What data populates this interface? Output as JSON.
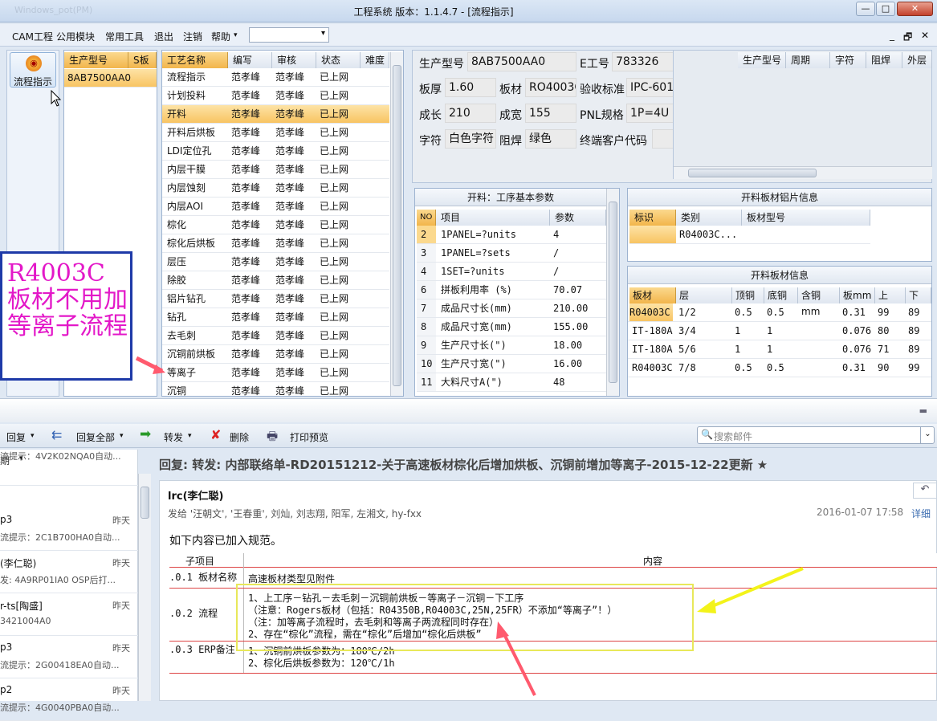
{
  "window": {
    "title": "工程系统  版本：1.1.4.7 - [流程指示]",
    "blurred_title": "Windows_pot(PM)",
    "min": "—",
    "max": "□",
    "close": "✕"
  },
  "menu": {
    "items": [
      "CAM工程",
      "公用模块",
      "常用工具",
      "退出",
      "注销",
      "帮助"
    ],
    "combo_value": "",
    "right_buttons": [
      "_",
      "🗗",
      "✕"
    ]
  },
  "leftnav": {
    "button_label": "流程指示"
  },
  "model_list": {
    "headers": [
      "生产型号",
      "S板"
    ],
    "rows": [
      "8AB7500AA0"
    ]
  },
  "process_list": {
    "headers": [
      "工艺名称",
      "编写",
      "审核",
      "状态",
      "难度"
    ],
    "rows": [
      [
        "流程指示",
        "范孝峰",
        "范孝峰",
        "已上网"
      ],
      [
        "计划投料",
        "范孝峰",
        "范孝峰",
        "已上网"
      ],
      [
        "开料",
        "范孝峰",
        "范孝峰",
        "已上网"
      ],
      [
        "开料后烘板",
        "范孝峰",
        "范孝峰",
        "已上网"
      ],
      [
        "LDI定位孔",
        "范孝峰",
        "范孝峰",
        "已上网"
      ],
      [
        "内层干膜",
        "范孝峰",
        "范孝峰",
        "已上网"
      ],
      [
        "内层蚀刻",
        "范孝峰",
        "范孝峰",
        "已上网"
      ],
      [
        "内层AOI",
        "范孝峰",
        "范孝峰",
        "已上网"
      ],
      [
        "棕化",
        "范孝峰",
        "范孝峰",
        "已上网"
      ],
      [
        "棕化后烘板",
        "范孝峰",
        "范孝峰",
        "已上网"
      ],
      [
        "层压",
        "范孝峰",
        "范孝峰",
        "已上网"
      ],
      [
        "除胶",
        "范孝峰",
        "范孝峰",
        "已上网"
      ],
      [
        "铝片钻孔",
        "范孝峰",
        "范孝峰",
        "已上网"
      ],
      [
        "钻孔",
        "范孝峰",
        "范孝峰",
        "已上网"
      ],
      [
        "去毛刺",
        "范孝峰",
        "范孝峰",
        "已上网"
      ],
      [
        "沉铜前烘板",
        "范孝峰",
        "范孝峰",
        "已上网"
      ],
      [
        "等离子",
        "范孝峰",
        "范孝峰",
        "已上网"
      ],
      [
        "沉铜",
        "范孝峰",
        "范孝峰",
        "已上网"
      ]
    ],
    "selected_index": 2
  },
  "info": {
    "model_label": "生产型号",
    "model": "8AB7500AA0",
    "eno_label": "E工号",
    "eno": "783326",
    "thick_label": "板厚",
    "thick": "1.60",
    "mat_label": "板材",
    "mat": "RO4003C",
    "std_label": "验收标准",
    "std": "IPC-601",
    "len_label": "成长",
    "len": "210",
    "wid_label": "成宽",
    "wid": "155",
    "pnl_label": "PNL规格",
    "pnl": "1P=4U",
    "char_label": "字符",
    "char": "白色字符",
    "mask_label": "阻焊",
    "mask": "绿色",
    "cust_label": "终端客户代码",
    "cust": ""
  },
  "right_table": {
    "headers": [
      "生产型号",
      "周期",
      "字符",
      "阻焊",
      "外层"
    ]
  },
  "params": {
    "title": "开料：工序基本参数",
    "headers": [
      "NO",
      "项目",
      "参数"
    ],
    "rows": [
      [
        "2",
        "1PANEL=?units",
        "4"
      ],
      [
        "3",
        "1PANEL=?sets",
        "/"
      ],
      [
        "4",
        "1SET=?units",
        "/"
      ],
      [
        "6",
        "拼板利用率 (%)",
        "70.07"
      ],
      [
        "7",
        "成品尺寸长(mm)",
        "210.00"
      ],
      [
        "8",
        "成品尺寸宽(mm)",
        "155.00"
      ],
      [
        "9",
        "生产尺寸长(\")",
        "18.00"
      ],
      [
        "10",
        "生产尺寸宽(\")",
        "16.00"
      ],
      [
        "11",
        "大料尺寸A(\")",
        "48"
      ]
    ]
  },
  "alu": {
    "title": "开料板材铝片信息",
    "headers": [
      "标识",
      "类别",
      "板材型号"
    ],
    "rows": [
      [
        "",
        "R04003C..."
      ]
    ]
  },
  "mats": {
    "title": "开料板材信息",
    "headers": [
      "板材",
      "层",
      "顶铜",
      "底铜",
      "含铜mm",
      "板mm",
      "上",
      "下"
    ],
    "rows": [
      [
        "R04003C",
        "1/2",
        "0.5",
        "0.5",
        "",
        "0.31",
        "99",
        "89"
      ],
      [
        "IT-180A",
        "3/4",
        "1",
        "1",
        "",
        "0.076",
        "80",
        "89"
      ],
      [
        "IT-180A",
        "5/6",
        "1",
        "1",
        "",
        "0.076",
        "71",
        "89"
      ],
      [
        "R04003C",
        "7/8",
        "0.5",
        "0.5",
        "",
        "0.31",
        "90",
        "99"
      ]
    ]
  },
  "annotation": {
    "text": "R4003C板材不用加等离子流程"
  },
  "mail": {
    "toolbar": [
      "回复",
      "回复全部",
      "转发",
      "删除",
      "打印预览"
    ],
    "search_placeholder": "搜索邮件",
    "list_header": "期",
    "list": [
      {
        "s": "流提示：4V2K02NQA0自动...",
        "d": "",
        "p": ""
      },
      {
        "s": "p3",
        "d": "昨天",
        "p": "流提示：2C1B700HA0自动..."
      },
      {
        "s": "(李仁聪)",
        "d": "昨天",
        "p": "发: 4A9RP01IA0   OSP后打..."
      },
      {
        "s": "r-ts[陶盛]",
        "d": "昨天",
        "p": "3421004A0"
      },
      {
        "s": "p3",
        "d": "昨天",
        "p": "流提示：2G00418EA0自动..."
      },
      {
        "s": "p2",
        "d": "昨天",
        "p": "流提示：4G0040PBA0自动..."
      }
    ],
    "subject": "回复: 转发: 内部联络单-RD20151212-关于高速板材棕化后增加烘板、沉铜前增加等离子-2015-12-22更新 ★",
    "sender": "lrc(李仁聪)",
    "to": "发给 '汪朝文', '王春重', 刘灿, 刘志翔, 阳军, 左湘文, hy-fxx",
    "date": "2016-01-07 17:58",
    "detail": "详细",
    "intro": "如下内容已加入规范。",
    "table_headers": [
      "子项目",
      "内容"
    ],
    "table": [
      {
        "item": ".0.1 板材名称",
        "lines": [
          "高速板材类型见附件"
        ]
      },
      {
        "item": ".0.2 流程",
        "lines": [
          "1、上工序－钻孔－去毛刺－沉铜前烘板－等离子－沉铜－下工序",
          "（注意：Rogers板材（包括：R04350B,R04003C,25N,25FR）不添加“等离子”！）",
          "（注：加等离子流程时，去毛刺和等离子两流程同时存在）",
          "2、存在“棕化”流程，需在“棕化”后增加“棕化后烘板”"
        ]
      },
      {
        "item": ".0.3 ERP备注",
        "lines": [
          "1、沉铜前烘板参数为：180℃/2h",
          "2、棕化后烘板参数为：120℃/1h"
        ]
      }
    ]
  }
}
